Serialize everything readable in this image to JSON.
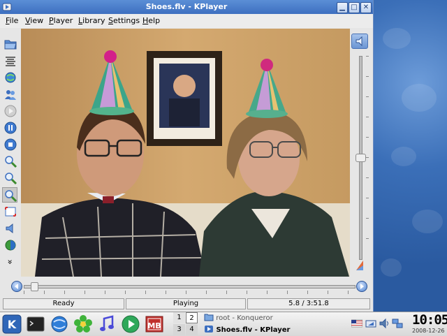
{
  "window": {
    "title": "Shoes.flv - KPlayer",
    "minimize_glyph": "▁",
    "maximize_glyph": "□",
    "close_glyph": "✕"
  },
  "menubar": {
    "items": [
      {
        "label": "File",
        "mnemonic": "F"
      },
      {
        "label": "View",
        "mnemonic": "V"
      },
      {
        "label": "Player",
        "mnemonic": "P"
      },
      {
        "label": "Library",
        "mnemonic": "L"
      },
      {
        "label": "Settings",
        "mnemonic": "S"
      },
      {
        "label": "Help",
        "mnemonic": "H"
      }
    ]
  },
  "toolbar": {
    "buttons": [
      {
        "icon": "open-folder-icon"
      },
      {
        "icon": "playlist-icon"
      },
      {
        "icon": "open-url-icon"
      },
      {
        "icon": "users-icon"
      },
      {
        "icon": "play-icon"
      },
      {
        "icon": "pause-icon"
      },
      {
        "icon": "stop-icon"
      },
      {
        "icon": "zoom-in-icon"
      },
      {
        "icon": "zoom-out-icon"
      },
      {
        "icon": "zoom-original-icon",
        "active": true
      },
      {
        "icon": "fullscreen-icon"
      },
      {
        "icon": "volume-icon"
      },
      {
        "icon": "contrast-icon"
      },
      {
        "icon": "more-icon",
        "glyph": "»"
      }
    ]
  },
  "video": {
    "content": "two-people-party-hats-video-frame"
  },
  "volume": {
    "level_fraction": 0.5,
    "button_icon": "volume-icon",
    "mute_icon": "volume-ramp-icon"
  },
  "progress": {
    "position_fraction": 0.025,
    "back_icon": "seek-back-icon",
    "forward_icon": "seek-forward-icon"
  },
  "status": {
    "state": "Ready",
    "playback": "Playing",
    "time": "5.8 / 3:51.8"
  },
  "taskbar": {
    "launchers": [
      "kde-menu-icon",
      "terminal-icon",
      "konqueror-globe-icon",
      "icq-flower-icon",
      "music-note-icon",
      "media-player-icon",
      "kmb-icon"
    ],
    "pager": [
      "1",
      "2",
      "3",
      "4"
    ],
    "active_desktop": "2",
    "tasks": [
      {
        "label": "root - Konqueror",
        "icon": "folder-icon",
        "active": false
      },
      {
        "label": "Shoes.flv - KPlayer",
        "icon": "kplayer-icon",
        "active": true
      }
    ],
    "tray": [
      "keyboard-flag-icon",
      "kmix-volume-icon",
      "speaker-icon",
      "network-icon"
    ],
    "clock_time": "10:05",
    "clock_date": "2008-12-26"
  },
  "colors": {
    "titlebar": "#4a7ecb",
    "desktop": "#3b6fb8",
    "accent": "#4e82d0"
  }
}
